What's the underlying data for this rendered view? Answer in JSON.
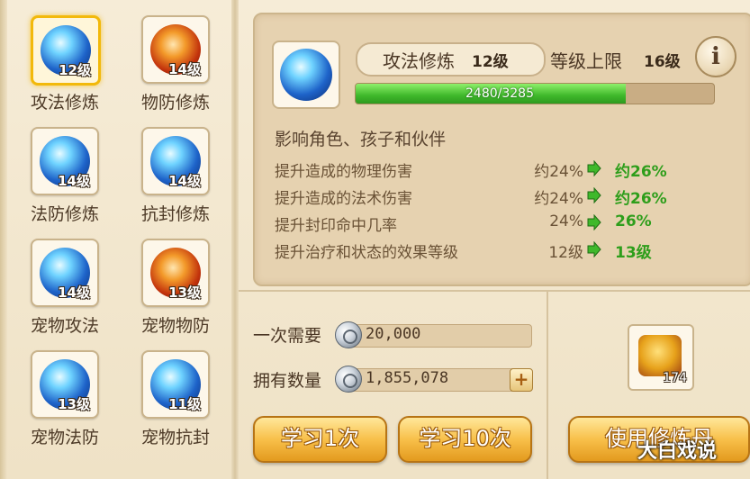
{
  "skills": [
    {
      "name": "攻法修炼",
      "level": "12级",
      "theme": "blue",
      "selected": true
    },
    {
      "name": "物防修炼",
      "level": "14级",
      "theme": "red",
      "selected": false
    },
    {
      "name": "法防修炼",
      "level": "14级",
      "theme": "blue",
      "selected": false
    },
    {
      "name": "抗封修炼",
      "level": "14级",
      "theme": "blue",
      "selected": false
    },
    {
      "name": "宠物攻法",
      "level": "14级",
      "theme": "blue",
      "selected": false
    },
    {
      "name": "宠物物防",
      "level": "13级",
      "theme": "red",
      "selected": false
    },
    {
      "name": "宠物法防",
      "level": "13级",
      "theme": "blue",
      "selected": false
    },
    {
      "name": "宠物抗封",
      "level": "11级",
      "theme": "blue",
      "selected": false
    }
  ],
  "detail": {
    "title": "攻法修炼",
    "level": "12级",
    "cap_label": "等级上限",
    "cap_value": "16级",
    "info_glyph": "i",
    "progress_text": "2480/3285",
    "progress_ratio": 0.755,
    "affects": "影响角色、孩子和伙伴",
    "stats": [
      {
        "desc": "提升造成的物理伤害",
        "from": "约24%",
        "to": "约26%"
      },
      {
        "desc": "提升造成的法术伤害",
        "from": "约24%",
        "to": "约26%"
      },
      {
        "desc": "提升封印命中几率",
        "from": "24%",
        "to": "26%"
      },
      {
        "desc": "提升治疗和状态的效果等级",
        "from": "12级",
        "to": "13级"
      }
    ]
  },
  "cost": {
    "label": "一次需要",
    "value": "20,000",
    "currency_icon": "silver-coin-icon"
  },
  "owned": {
    "label": "拥有数量",
    "value": "1,855,078",
    "plus": "+"
  },
  "buttons": {
    "learn_once": "学习1次",
    "learn_ten": "学习10次",
    "use_item": "使用修炼丹"
  },
  "item": {
    "count": "174",
    "icon": "treasure-chest-icon"
  },
  "watermark": "大白戏说",
  "colors": {
    "accent": "#f2b90b",
    "progress": "#3fb82b",
    "increase": "#2e9e1b",
    "button": "#f8c04a"
  }
}
